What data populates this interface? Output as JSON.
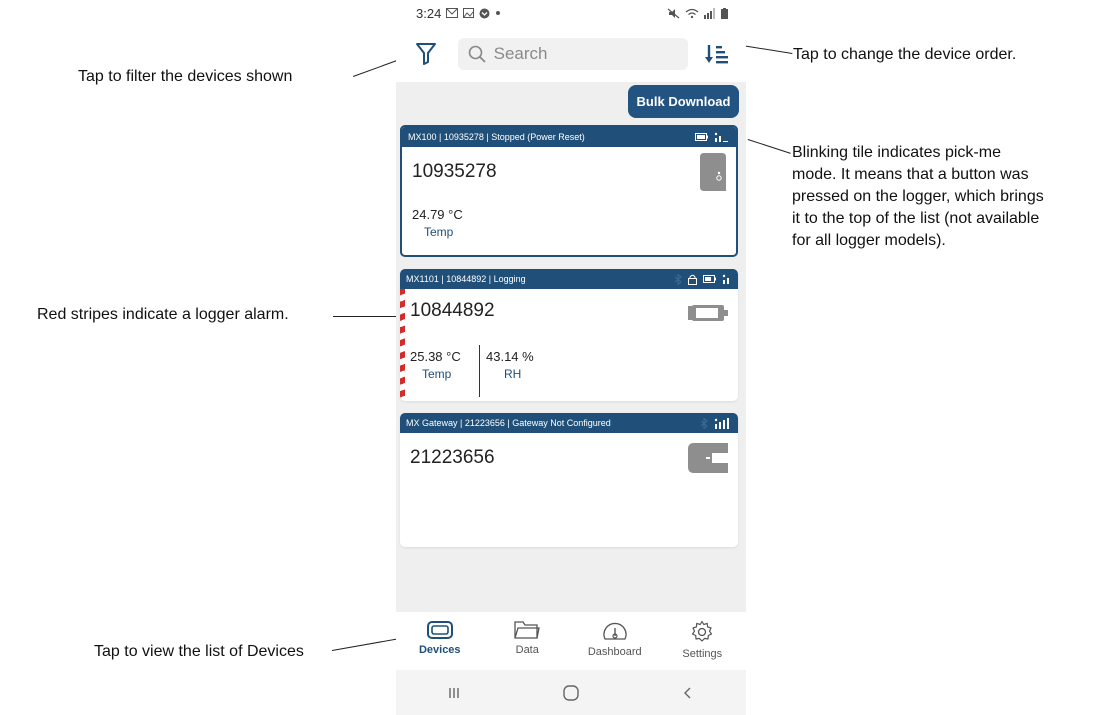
{
  "annotations": {
    "filter": "Tap to filter the devices shown",
    "order": "Tap to change the device order.",
    "blink_lines": [
      "Blinking tile indicates pick-me",
      "mode. It means that a button was",
      "pressed on the logger, which brings",
      "it to the top of the list (not available",
      "for all logger models)."
    ],
    "alarm": "Red stripes indicate a logger alarm.",
    "devices": "Tap to view the list of Devices"
  },
  "status_bar": {
    "time": "3:24"
  },
  "search": {
    "placeholder": "Search"
  },
  "bulk_download": "Bulk Download",
  "tiles": [
    {
      "header": "MX100 | 10935278 | Stopped (Power Reset)",
      "serial": "10935278",
      "readings": [
        {
          "value": "24.79 °C",
          "label": "Temp"
        }
      ]
    },
    {
      "header": "MX1101 | 10844892 | Logging",
      "serial": "10844892",
      "readings": [
        {
          "value": "25.38 °C",
          "label": "Temp"
        },
        {
          "value": "43.14 %",
          "label": "RH"
        }
      ]
    },
    {
      "header": "MX Gateway | 21223656 | Gateway Not Configured",
      "serial": "21223656",
      "readings": []
    }
  ],
  "nav": {
    "items": [
      {
        "label": "Devices",
        "icon": "devices-icon"
      },
      {
        "label": "Data",
        "icon": "folder-icon"
      },
      {
        "label": "Dashboard",
        "icon": "gauge-icon"
      },
      {
        "label": "Settings",
        "icon": "gear-icon"
      }
    ],
    "active": "Devices"
  },
  "colors": {
    "primary": "#205079",
    "alarm": "#d42b2b",
    "background": "#efefef"
  }
}
